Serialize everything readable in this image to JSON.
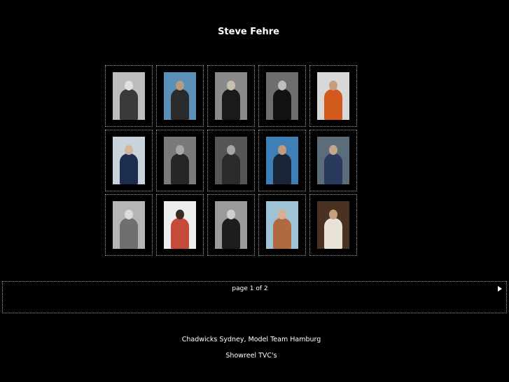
{
  "page": {
    "title": "Steve Fehre"
  },
  "gallery": {
    "thumbnails": [
      {
        "name": "photo-1-bw-group",
        "bg": "#bdbdbd",
        "fig": "#3a3a3a",
        "head": "#e0e0e0"
      },
      {
        "name": "photo-2-kneeling",
        "bg": "#5a8fb8",
        "fig": "#2a2a2a",
        "head": "#b89a7e"
      },
      {
        "name": "photo-3-portrait-suit",
        "bg": "#8a8a8a",
        "fig": "#1a1a1a",
        "head": "#c9c0b3"
      },
      {
        "name": "photo-4-portrait-dark",
        "bg": "#6e6e6e",
        "fig": "#121212",
        "head": "#bdbdbd"
      },
      {
        "name": "photo-5-orange-scarf",
        "bg": "#d8d8d8",
        "fig": "#d15a1c",
        "head": "#c89f7e"
      },
      {
        "name": "photo-6-navy-suit",
        "bg": "#c9d3dc",
        "fig": "#1d2d4f",
        "head": "#d2b69b"
      },
      {
        "name": "photo-7-sunglasses",
        "bg": "#7a7a7a",
        "fig": "#262626",
        "head": "#a8a8a8"
      },
      {
        "name": "photo-8-bw-jacket",
        "bg": "#555555",
        "fig": "#2b2b2b",
        "head": "#a5a5a5"
      },
      {
        "name": "photo-9-waterski",
        "bg": "#3f7fb8",
        "fig": "#1a2538",
        "head": "#c49b7a"
      },
      {
        "name": "photo-10-blue-suit",
        "bg": "#5b6c7a",
        "fig": "#2a3a5c",
        "head": "#c3a78d"
      },
      {
        "name": "photo-11-coat",
        "bg": "#b5b5b5",
        "fig": "#6f6f6f",
        "head": "#dcdcdc"
      },
      {
        "name": "photo-12-circle-ad",
        "bg": "#eeeeee",
        "fig": "#c44b3a",
        "head": "#3a2a22"
      },
      {
        "name": "photo-13-closeup",
        "bg": "#9a9a9a",
        "fig": "#1d1d1d",
        "head": "#cfcfcf"
      },
      {
        "name": "photo-14-beach",
        "bg": "#9fc3d6",
        "fig": "#b06a3e",
        "head": "#d8b090"
      },
      {
        "name": "photo-15-piano",
        "bg": "#4a3222",
        "fig": "#e8e2d8",
        "head": "#c7a080"
      }
    ]
  },
  "pager": {
    "label": "page 1 of 2",
    "next_icon": "right-triangle"
  },
  "footer": {
    "agencies": "Chadwicks Sydney, Model Team Hamburg",
    "showreel": "Showreel TVC's"
  }
}
